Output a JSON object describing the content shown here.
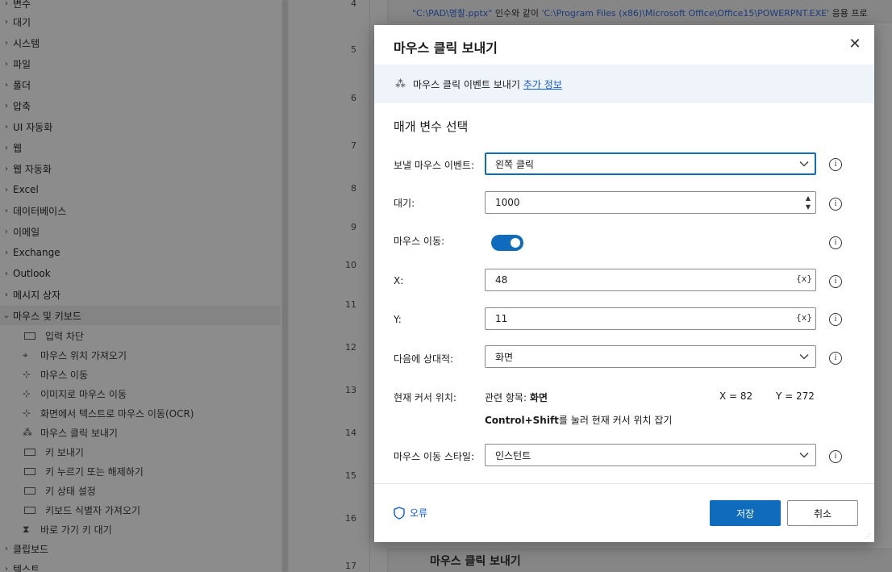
{
  "sidebar": {
    "categories": [
      {
        "label": "변수",
        "expanded": false
      },
      {
        "label": "대기",
        "expanded": false
      },
      {
        "label": "시스템",
        "expanded": false
      },
      {
        "label": "파일",
        "expanded": false
      },
      {
        "label": "폴더",
        "expanded": false
      },
      {
        "label": "압축",
        "expanded": false
      },
      {
        "label": "UI 자동화",
        "expanded": false
      },
      {
        "label": "웹",
        "expanded": false
      },
      {
        "label": "웹 자동화",
        "expanded": false
      },
      {
        "label": "Excel",
        "expanded": false
      },
      {
        "label": "데이터베이스",
        "expanded": false
      },
      {
        "label": "이메일",
        "expanded": false
      },
      {
        "label": "Exchange",
        "expanded": false
      },
      {
        "label": "Outlook",
        "expanded": false
      },
      {
        "label": "메시지 상자",
        "expanded": false
      },
      {
        "label": "마우스 및 키보드",
        "expanded": true
      }
    ],
    "mouse_keyboard_items": [
      {
        "label": "입력 차단",
        "icon": "keyboard-icon"
      },
      {
        "label": "마우스 위치 가져오기",
        "icon": "crosshair-icon"
      },
      {
        "label": "마우스 이동",
        "icon": "mouse-move-icon"
      },
      {
        "label": "이미지로 마우스 이동",
        "icon": "mouse-move-icon"
      },
      {
        "label": "화면에서 텍스트로 마우스 이동(OCR)",
        "icon": "mouse-move-icon"
      },
      {
        "label": "마우스 클릭 보내기",
        "icon": "mouse-click-icon"
      },
      {
        "label": "키 보내기",
        "icon": "keyboard-icon"
      },
      {
        "label": "키 누르기 또는 해제하기",
        "icon": "keyboard-icon"
      },
      {
        "label": "키 상태 설정",
        "icon": "keyboard-icon"
      },
      {
        "label": "키보드 식별자 가져오기",
        "icon": "keyboard-icon"
      },
      {
        "label": "바로 가기 키 대기",
        "icon": "hourglass-icon"
      }
    ],
    "bottom_categories": [
      {
        "label": "클립보드"
      },
      {
        "label": "텍스트"
      }
    ]
  },
  "canvas": {
    "line_numbers": [
      "4",
      "5",
      "6",
      "7",
      "8",
      "9",
      "10",
      "11",
      "12",
      "13",
      "14",
      "15",
      "16",
      "17"
    ],
    "top_step": {
      "text_a": "\"C:\\PAD\\명찰.pptx\"",
      "text_b": " 인수와 같이 ",
      "text_c": "'C:\\Program Files (x86)\\Microsoft Office\\Office15\\POWERPNT.EXE'",
      "text_d": " 응용 프로"
    },
    "bottom_step": {
      "title": "마우스 클릭 보내기"
    }
  },
  "dialog": {
    "title": "마우스 클릭 보내기",
    "info_text": "마우스 클릭 이벤트 보내기",
    "info_link": "추가 정보",
    "section_title": "매개 변수 선택",
    "fields": {
      "event_label": "보낼 마우스 이벤트:",
      "event_value": "왼쪽 클릭",
      "delay_label": "대기:",
      "delay_value": "1000",
      "move_label": "마우스 이동:",
      "move_enabled": true,
      "x_label": "X:",
      "x_value": "48",
      "y_label": "Y:",
      "y_value": "11",
      "relative_label": "다음에 상대적:",
      "relative_value": "화면",
      "cursor_label": "현재 커서 위치:",
      "cursor_rel_prefix": "관련 항목: ",
      "cursor_rel_value": "화면",
      "cursor_x": "X = 82",
      "cursor_y": "Y = 272",
      "cursor_hint_keys": "Control+Shift",
      "cursor_hint_rest": "를 눌러 현재 커서 위치 잡기",
      "style_label": "마우스 이동 스타일:",
      "style_value": "인스턴트"
    },
    "variable_button": "{x}",
    "error_label": "오류",
    "save_label": "저장",
    "cancel_label": "취소"
  },
  "colors": {
    "accent": "#0f6cbd",
    "link": "#0f5bd1",
    "info_bar": "#eff4fb"
  }
}
